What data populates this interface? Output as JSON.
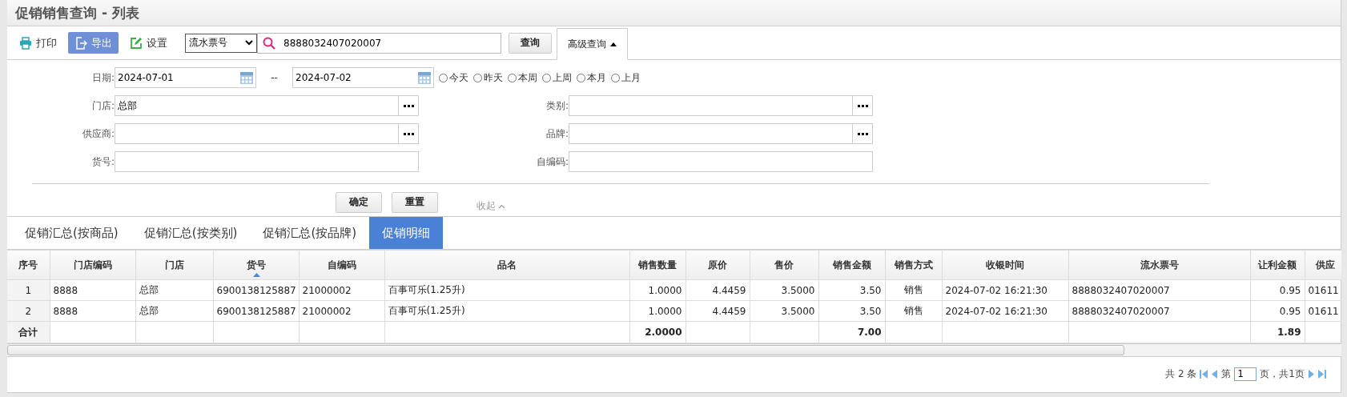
{
  "title": "促销销售查询 - 列表",
  "toolbar": {
    "print": "打印",
    "export": "导出",
    "settings": "设置",
    "search_type": "流水票号",
    "search_value": "8888032407020007",
    "query": "查询",
    "advanced": "高级查询"
  },
  "form": {
    "date_label": "日期:",
    "date_from": "2024-07-01",
    "date_sep": "--",
    "date_to": "2024-07-02",
    "quick_dates": [
      {
        "label": "今天",
        "selected": false
      },
      {
        "label": "昨天",
        "selected": false
      },
      {
        "label": "本周",
        "selected": false
      },
      {
        "label": "上周",
        "selected": false
      },
      {
        "label": "本月",
        "selected": false
      },
      {
        "label": "上月",
        "selected": false
      }
    ],
    "fields": [
      {
        "label": "门店:",
        "value": "总部",
        "kind": "picker"
      },
      {
        "label": "类别:",
        "kind": "picker"
      },
      {
        "label": "供应商:",
        "kind": "picker"
      },
      {
        "label": "品牌:",
        "kind": "picker"
      },
      {
        "label": "货号:",
        "kind": "text"
      },
      {
        "label": "自编码:",
        "kind": "text"
      }
    ],
    "confirm": "确定",
    "reset": "重置",
    "collapse": "收起"
  },
  "tabs": [
    {
      "label": "促销汇总(按商品)",
      "selected": false
    },
    {
      "label": "促销汇总(按类别)",
      "selected": false
    },
    {
      "label": "促销汇总(按品牌)",
      "selected": false
    },
    {
      "label": "促销明细",
      "selected": true
    }
  ],
  "table": {
    "columns": [
      {
        "label": "序号",
        "sorted": false
      },
      {
        "label": "门店编码",
        "sorted": false
      },
      {
        "label": "门店",
        "sorted": false
      },
      {
        "label": "货号",
        "sorted": true
      },
      {
        "label": "自编码",
        "sorted": false
      },
      {
        "label": "品名",
        "sorted": false
      },
      {
        "label": "销售数量",
        "sorted": false
      },
      {
        "label": "原价",
        "sorted": false
      },
      {
        "label": "售价",
        "sorted": false
      },
      {
        "label": "销售金额",
        "sorted": false
      },
      {
        "label": "销售方式",
        "sorted": false
      },
      {
        "label": "收银时间",
        "sorted": false
      },
      {
        "label": "流水票号",
        "sorted": false
      },
      {
        "label": "让利金额",
        "sorted": false
      },
      {
        "label": "供应",
        "sorted": false
      }
    ],
    "rows": [
      [
        "1",
        "8888",
        "总部",
        "6900138125887",
        "21000002",
        "百事可乐(1.25升)",
        "1.0000",
        "4.4459",
        "3.5000",
        "3.50",
        "销售",
        "2024-07-02 16:21:30",
        "8888032407020007",
        "0.95",
        "01611"
      ],
      [
        "2",
        "8888",
        "总部",
        "6900138125887",
        "21000002",
        "百事可乐(1.25升)",
        "1.0000",
        "4.4459",
        "3.5000",
        "3.50",
        "销售",
        "2024-07-02 16:21:30",
        "8888032407020007",
        "0.95",
        "01611"
      ]
    ],
    "totals": {
      "label": "合计",
      "quantity": "2.0000",
      "amount": "7.00",
      "discount": "1.89"
    }
  },
  "pager": {
    "total": "共 2 条",
    "page_prefix": "第",
    "page": "1",
    "page_suffix": "页，共1页"
  }
}
